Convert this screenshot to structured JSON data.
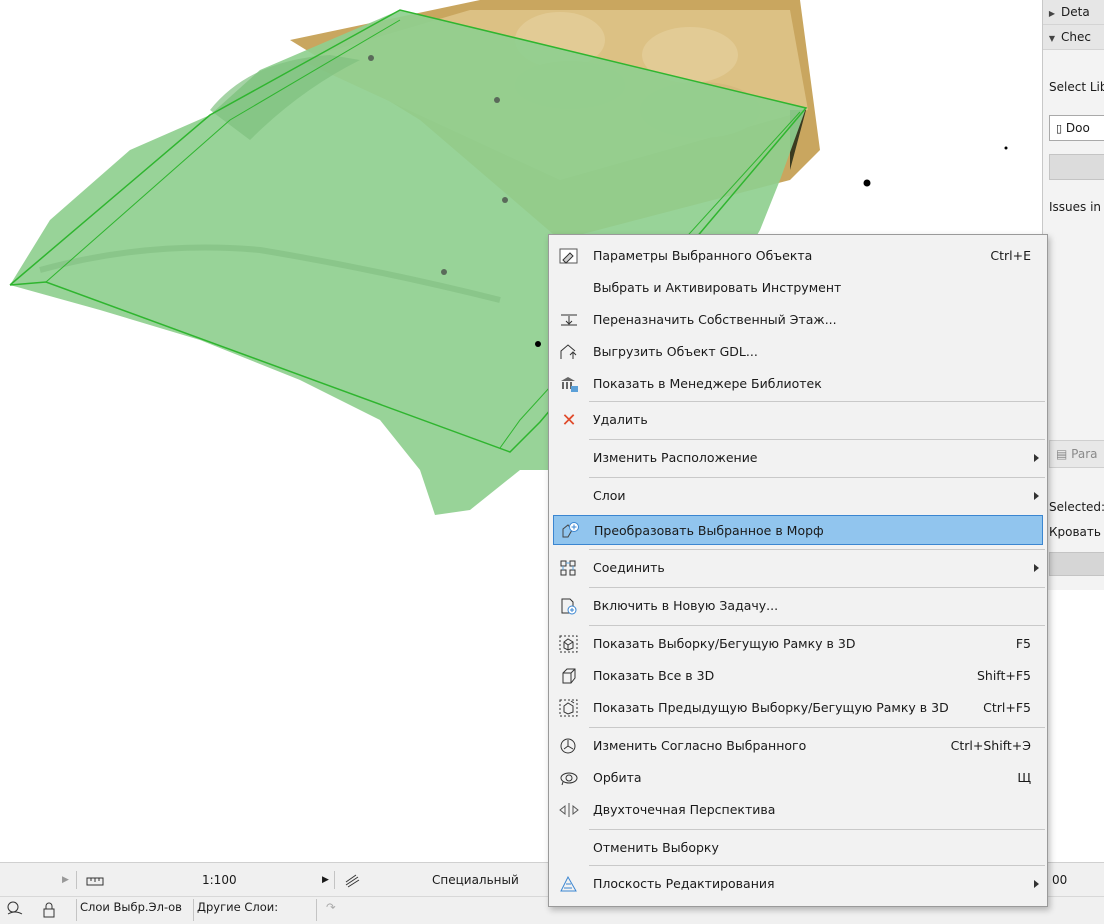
{
  "context_menu": {
    "items": [
      {
        "label": "Параметры Выбранного Объекта",
        "shortcut": "Ctrl+E",
        "icon": "object-settings-icon"
      },
      {
        "label": "Выбрать и Активировать Инструмент",
        "shortcut": "",
        "icon": ""
      },
      {
        "label": "Переназначить Собственный Этаж...",
        "shortcut": "",
        "icon": "reassign-story-icon"
      },
      {
        "label": "Выгрузить Объект GDL...",
        "shortcut": "",
        "icon": "export-gdl-icon"
      },
      {
        "label": "Показать в Менеджере Библиотек",
        "shortcut": "",
        "icon": "library-manager-icon"
      },
      {
        "label": "Удалить",
        "shortcut": "",
        "icon": "delete-icon"
      },
      {
        "label": "Изменить Расположение",
        "shortcut": "",
        "icon": ""
      },
      {
        "label": "Слои",
        "shortcut": "",
        "icon": ""
      },
      {
        "label": "Преобразовать Выбранное в Морф",
        "shortcut": "",
        "icon": "convert-to-morph-icon"
      },
      {
        "label": "Соединить",
        "shortcut": "",
        "icon": "connect-icon"
      },
      {
        "label": "Включить в Новую Задачу...",
        "shortcut": "",
        "icon": "new-task-icon"
      },
      {
        "label": "Показать Выборку/Бегущую Рамку в 3D",
        "shortcut": "F5",
        "icon": "show-selection-3d-icon"
      },
      {
        "label": "Показать Все в 3D",
        "shortcut": "Shift+F5",
        "icon": "show-all-3d-icon"
      },
      {
        "label": "Показать Предыдущую Выборку/Бегущую Рамку в 3D",
        "shortcut": "Ctrl+F5",
        "icon": "show-previous-selection-3d-icon"
      },
      {
        "label": "Изменить Согласно Выбранного",
        "shortcut": "Ctrl+Shift+Э",
        "icon": "modify-by-selection-icon"
      },
      {
        "label": "Орбита",
        "shortcut": "Щ",
        "icon": "orbit-icon"
      },
      {
        "label": "Двухточечная Перспектива",
        "shortcut": "",
        "icon": "two-point-perspective-icon"
      },
      {
        "label": "Отменить Выборку",
        "shortcut": "",
        "icon": ""
      },
      {
        "label": "Плоскость Редактирования",
        "shortcut": "",
        "icon": "editing-plane-icon"
      }
    ]
  },
  "side_panel": {
    "details_label": "Deta",
    "check_label": "Chec",
    "select_lib_label": "Select Lib",
    "lib_value": "Doo",
    "issues_label": "Issues in",
    "param_label": "Para",
    "selected_label": "Selected:",
    "selected_value": "Кровать"
  },
  "status_bar": {
    "scale": "1:100",
    "model_view": "Специальный",
    "right_value": "00"
  },
  "layer_bar": {
    "selected_layers": "Слои Выбр.Эл-ов",
    "other_layers": "Другие Слои:"
  },
  "colors": {
    "highlight": "#91c5ee",
    "highlight_border": "#3b86d1",
    "menu_bg": "#f2f2f2",
    "delete_red": "#e04a2a",
    "bedsheet_green": "#8fcf8f",
    "headboard_tan": "#d9bd7f"
  }
}
